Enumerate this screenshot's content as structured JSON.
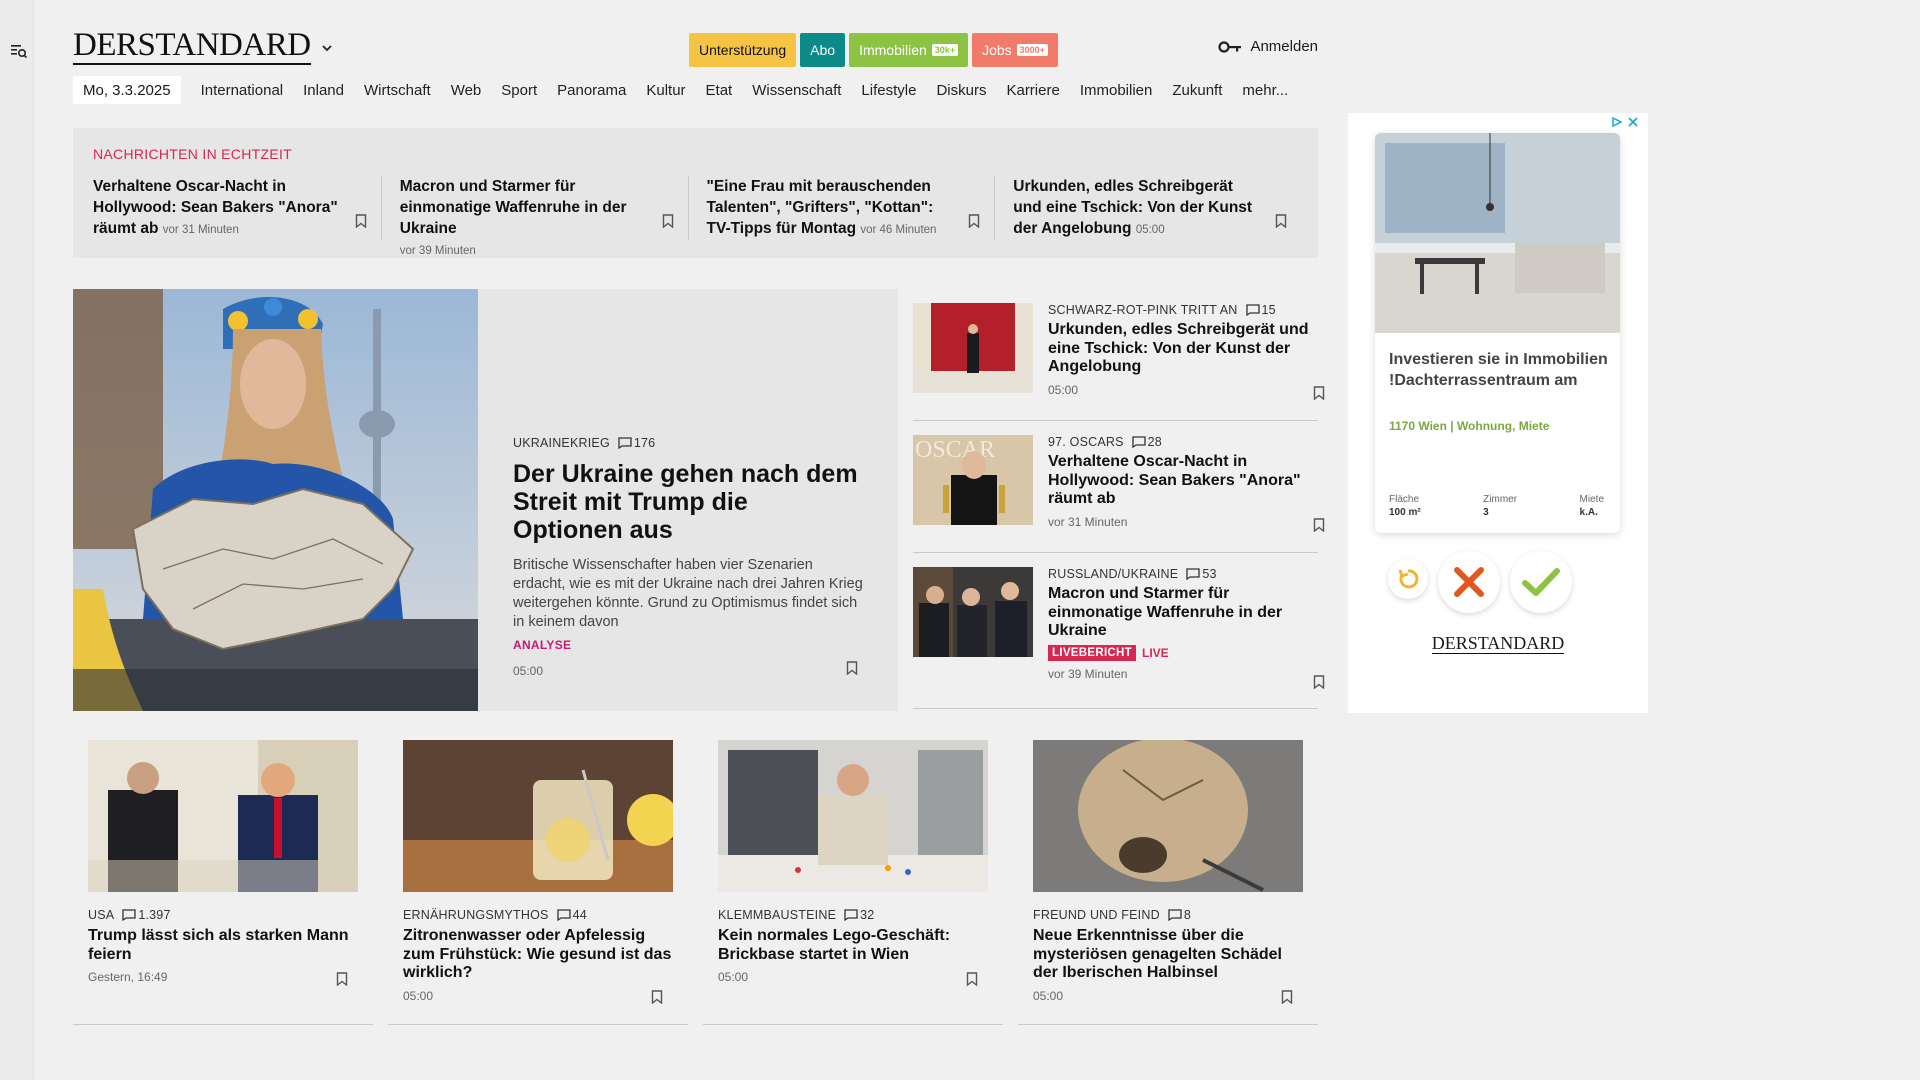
{
  "header": {
    "logo": "DERSTANDARD",
    "pills": [
      {
        "label": "Unterstützung",
        "tag": ""
      },
      {
        "label": "Abo",
        "tag": ""
      },
      {
        "label": "Immobilien",
        "tag": "30k+"
      },
      {
        "label": "Jobs",
        "tag": "3000+"
      }
    ],
    "login": "Anmelden"
  },
  "nav": {
    "date": "Mo, 3.3.2025",
    "items": [
      "International",
      "Inland",
      "Wirtschaft",
      "Web",
      "Sport",
      "Panorama",
      "Kultur",
      "Etat",
      "Wissenschaft",
      "Lifestyle",
      "Diskurs",
      "Karriere",
      "Immobilien",
      "Zukunft",
      "mehr..."
    ]
  },
  "ticker": {
    "label": "NACHRICHTEN IN ECHTZEIT",
    "items": [
      {
        "title": "Verhaltene Oscar-Nacht in Hollywood: Sean Bakers \"Anora\" räumt ab",
        "time": "vor 31 Minuten"
      },
      {
        "title": "Macron und Starmer für einmonatige Waffenruhe in der Ukraine",
        "time": "vor 39 Minuten"
      },
      {
        "title": "\"Eine Frau mit berauschenden Talenten\", \"Grifters\", \"Kottan\": TV-Tipps für Montag",
        "time": "vor 46 Minuten"
      },
      {
        "title": "Urkunden, edles Schreibgerät und eine Tschick: Von der Kunst der Angelobung",
        "time": "05:00"
      }
    ]
  },
  "hero": {
    "kicker": "UKRAINEKRIEG",
    "comments": "176",
    "title": "Der Ukraine gehen nach dem Streit mit Trump die Optionen aus",
    "teaser": "Britische Wissenschafter haben vier Szenarien erdacht, wie es mit der Ukraine nach drei Jahren Krieg weitergehen könnte. Grund zu Optimismus findet sich in keinem davon",
    "badge": "ANALYSE",
    "time": "05:00"
  },
  "side": [
    {
      "kicker": "SCHWARZ-ROT-PINK TRITT AN",
      "comments": "15",
      "title": "Urkunden, edles Schreibgerät und eine Tschick: Von der Kunst der Angelobung",
      "time": "05:00"
    },
    {
      "kicker": "97. OSCARS",
      "comments": "28",
      "title": "Verhaltene Oscar-Nacht in Hollywood: Sean Bakers \"Anora\" räumt ab",
      "time": "vor 31 Minuten"
    },
    {
      "kicker": "RUSSLAND/UKRAINE",
      "comments": "53",
      "title": "Macron und Starmer für einmonatige Waffenruhe in der Ukraine",
      "live_badge": "LIVEBERICHT",
      "live_text": "LIVE",
      "time": "vor 39 Minuten"
    }
  ],
  "cards": [
    {
      "kicker": "USA",
      "comments": "1.397",
      "title": "Trump lässt sich als starken Mann feiern",
      "time": "Gestern, 16:49"
    },
    {
      "kicker": "ERNÄHRUNGSMYTHOS",
      "comments": "44",
      "title": "Zitronenwasser oder Apfelessig zum Frühstück: Wie gesund ist das wirklich?",
      "time": "05:00"
    },
    {
      "kicker": "KLEMMBAUSTEINE",
      "comments": "32",
      "title": "Kein normales Lego-Geschäft: Brickbase startet in Wien",
      "time": "05:00"
    },
    {
      "kicker": "FREUND UND FEIND",
      "comments": "8",
      "title": "Neue Erkenntnisse über die mysteriösen genagelten Schädel der Iberischen Halbinsel",
      "time": "05:00"
    }
  ],
  "ad": {
    "title": "Investieren sie in Immobilien !Dachterrassentraum am",
    "location": "1170 Wien | Wohnung, Miete",
    "facts": [
      {
        "label": "Fläche",
        "value": "100 m²"
      },
      {
        "label": "Zimmer",
        "value": "3"
      },
      {
        "label": "Miete",
        "value": "k.A."
      }
    ],
    "logo": "DERSTANDARD"
  }
}
